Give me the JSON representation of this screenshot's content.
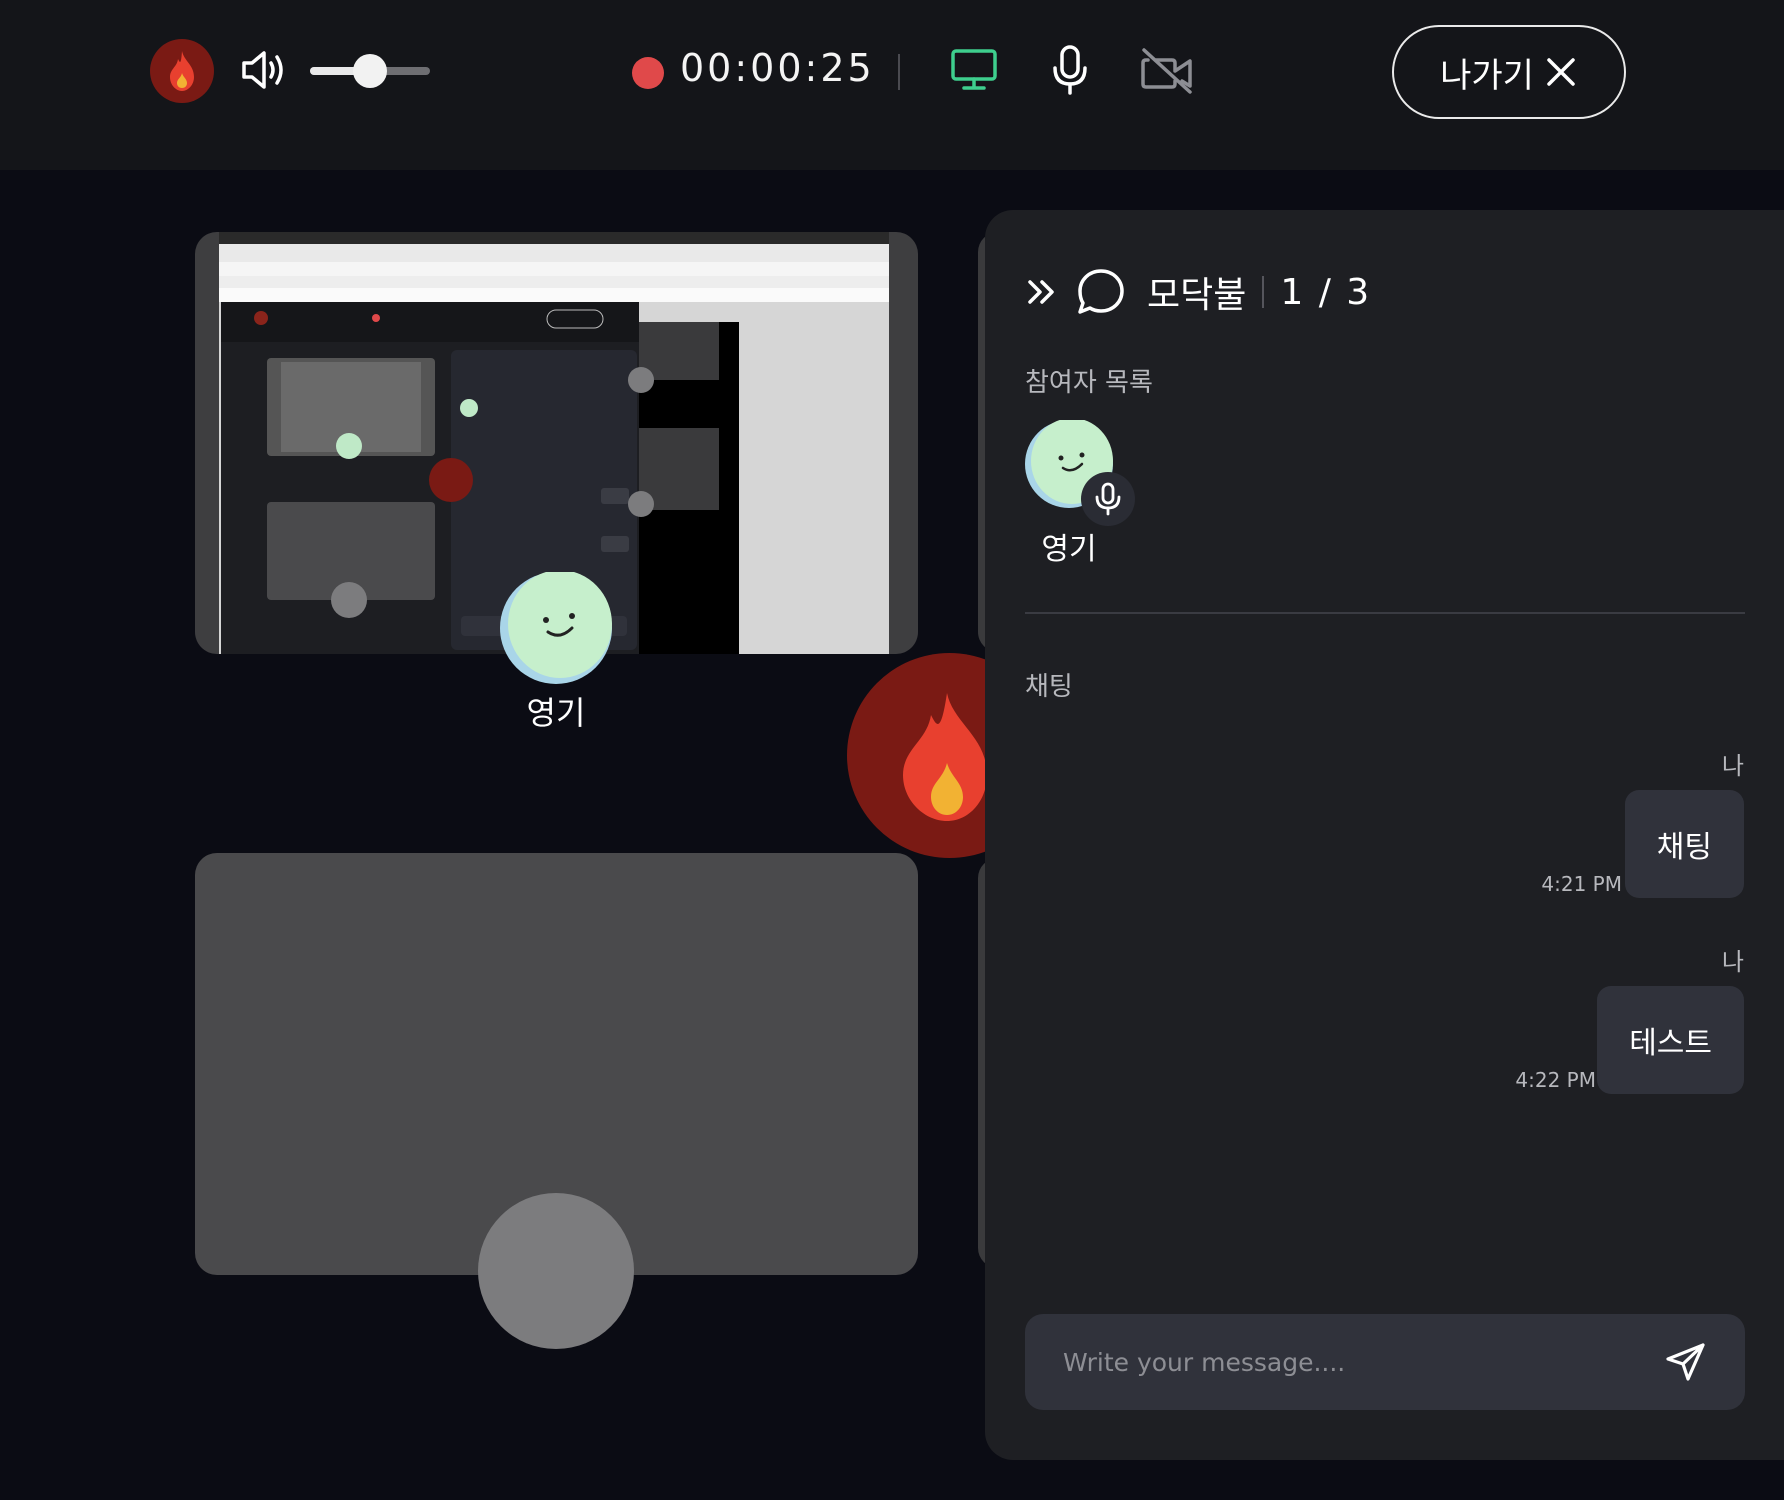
{
  "toolbar": {
    "timer": "00:00:25",
    "volume_level": 0.5,
    "exit_label": "나가기",
    "screen_share_color": "#3ecf8e",
    "record_color": "#e0494a"
  },
  "video": {
    "tiles": [
      {
        "participant": "영기",
        "sharing_screen": true
      },
      {
        "participant": "",
        "sharing_screen": false
      }
    ]
  },
  "chat_panel": {
    "room_name": "모닥불",
    "room_count": "1 / 3",
    "participants_label": "참여자 목록",
    "participants": [
      {
        "name": "영기",
        "mic_on": true
      }
    ],
    "chat_label": "채팅",
    "messages": [
      {
        "sender": "나",
        "text": "채팅",
        "time": "4:21 PM"
      },
      {
        "sender": "나",
        "text": "테스트",
        "time": "4:22 PM"
      }
    ],
    "input_placeholder": "Write your message...."
  }
}
